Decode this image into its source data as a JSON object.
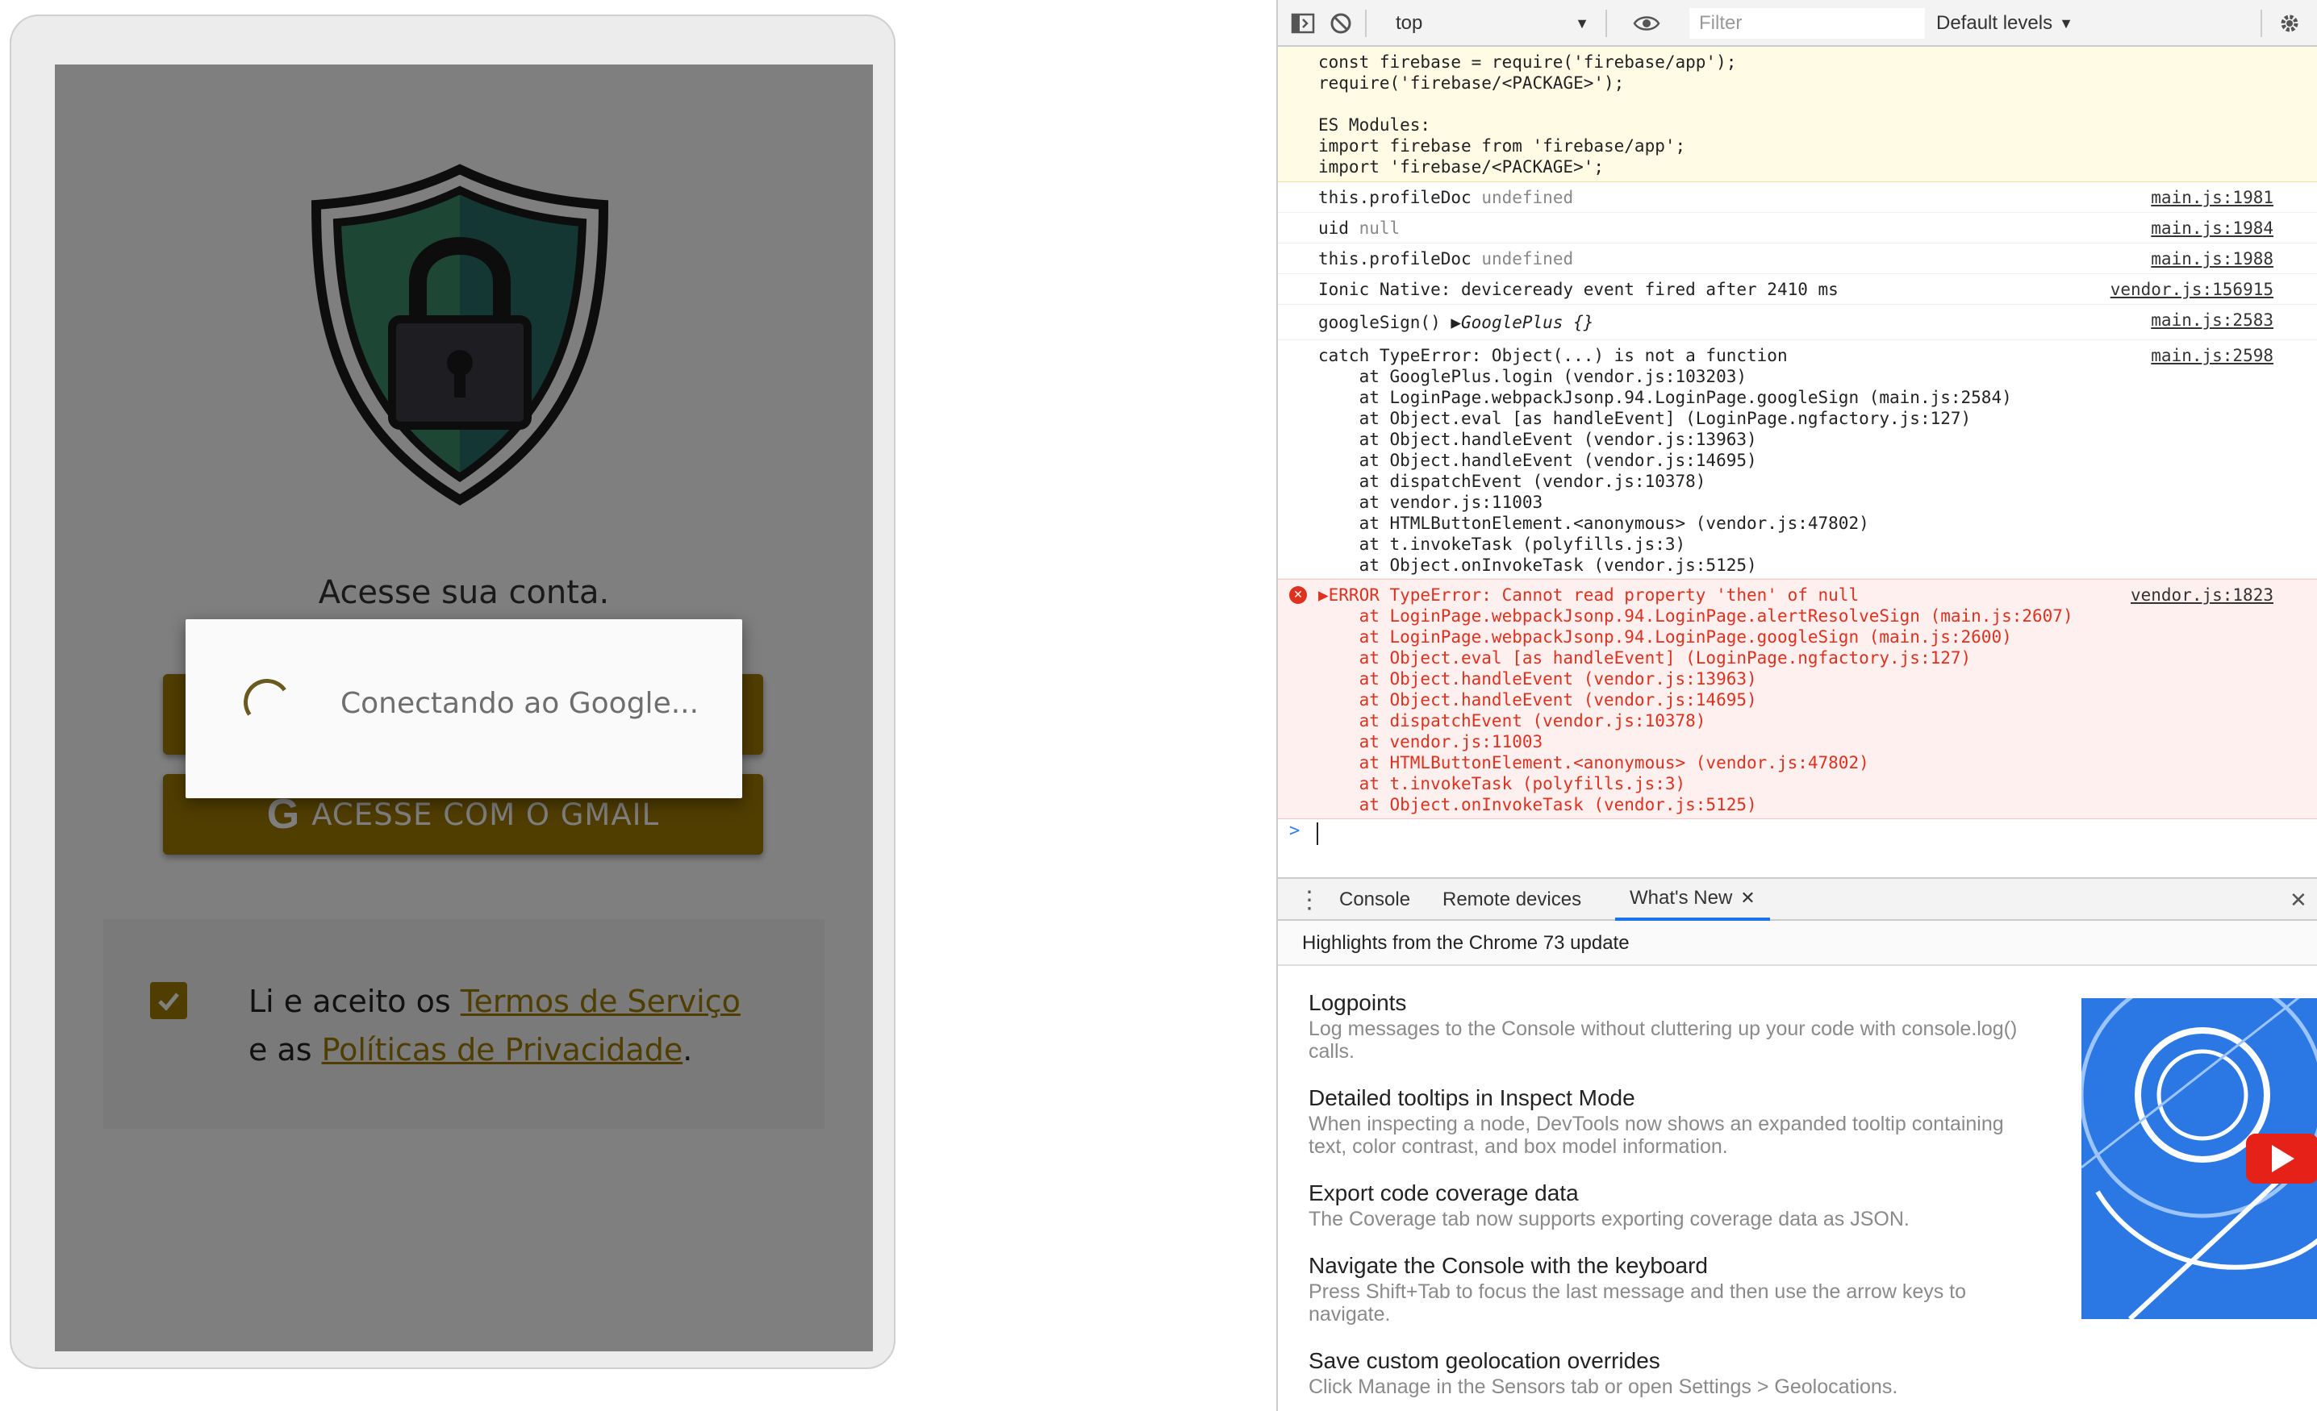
{
  "app": {
    "shield_alt": "shield-lock-icon",
    "title": "Acesse sua conta.",
    "buttons": {
      "login_label": "",
      "gmail_label": "ACESSE COM O GMAIL",
      "gmail_icon_glyph": "G"
    },
    "terms": {
      "prefix": "Li e aceito os ",
      "terms_link": "Termos de Serviço",
      "middle": " e as ",
      "privacy_link": "Políticas de Privacidade",
      "suffix": ".",
      "checked": true
    },
    "loading": {
      "message": "Conectando ao Google..."
    },
    "colors": {
      "accent": "#a07a00",
      "shield_green": "#3d8c68",
      "shield_teal": "#2a6f66"
    }
  },
  "devtools": {
    "toolbar": {
      "context": "top",
      "filter_placeholder": "Filter",
      "levels": "Default levels"
    },
    "console": {
      "warning_lines": [
        "const firebase = require('firebase/app');",
        "require('firebase/<PACKAGE>');",
        "",
        "ES Modules:",
        "import firebase from 'firebase/app';",
        "import 'firebase/<PACKAGE>';"
      ],
      "logs": [
        {
          "label": "this.profileDoc",
          "value": "undefined",
          "source": "main.js:1981"
        },
        {
          "label": "uid",
          "value": "null",
          "source": "main.js:1984"
        },
        {
          "label": "this.profileDoc",
          "value": "undefined",
          "source": "main.js:1988"
        },
        {
          "label": "Ionic Native: deviceready event fired after 2410 ms",
          "value": "",
          "source": "vendor.js:156915"
        },
        {
          "label": "googleSign()",
          "value": "▶GooglePlus {}",
          "source": "main.js:2583"
        }
      ],
      "catch_error": {
        "header": "catch TypeError: Object(...) is not a function",
        "source": "main.js:2598",
        "stack": [
          "    at GooglePlus.login (vendor.js:103203)",
          "    at LoginPage.webpackJsonp.94.LoginPage.googleSign (main.js:2584)",
          "    at Object.eval [as handleEvent] (LoginPage.ngfactory.js:127)",
          "    at Object.handleEvent (vendor.js:13963)",
          "    at Object.handleEvent (vendor.js:14695)",
          "    at dispatchEvent (vendor.js:10378)",
          "    at vendor.js:11003",
          "    at HTMLButtonElement.<anonymous> (vendor.js:47802)",
          "    at t.invokeTask (polyfills.js:3)",
          "    at Object.onInvokeTask (vendor.js:5125)"
        ]
      },
      "error": {
        "header": "▶ERROR TypeError: Cannot read property 'then' of null",
        "source": "vendor.js:1823",
        "stack": [
          "    at LoginPage.webpackJsonp.94.LoginPage.alertResolveSign (main.js:2607)",
          "    at LoginPage.webpackJsonp.94.LoginPage.googleSign (main.js:2600)",
          "    at Object.eval [as handleEvent] (LoginPage.ngfactory.js:127)",
          "    at Object.handleEvent (vendor.js:13963)",
          "    at Object.handleEvent (vendor.js:14695)",
          "    at dispatchEvent (vendor.js:10378)",
          "    at vendor.js:11003",
          "    at HTMLButtonElement.<anonymous> (vendor.js:47802)",
          "    at t.invokeTask (polyfills.js:3)",
          "    at Object.onInvokeTask (vendor.js:5125)"
        ]
      },
      "prompt": ">"
    },
    "drawer": {
      "tabs": [
        "Console",
        "Remote devices",
        "What's New"
      ],
      "active_tab": "What's New",
      "subtitle": "Highlights from the Chrome 73 update",
      "items": [
        {
          "title": "Logpoints",
          "desc": "Log messages to the Console without cluttering up your code with console.log() calls."
        },
        {
          "title": "Detailed tooltips in Inspect Mode",
          "desc": "When inspecting a node, DevTools now shows an expanded tooltip containing text, color contrast, and box model information."
        },
        {
          "title": "Export code coverage data",
          "desc": "The Coverage tab now supports exporting coverage data as JSON."
        },
        {
          "title": "Navigate the Console with the keyboard",
          "desc": "Press Shift+Tab to focus the last message and then use the arrow keys to navigate."
        },
        {
          "title": "Save custom geolocation overrides",
          "desc": "Click Manage in the Sensors tab or open Settings > Geolocations."
        }
      ]
    }
  }
}
